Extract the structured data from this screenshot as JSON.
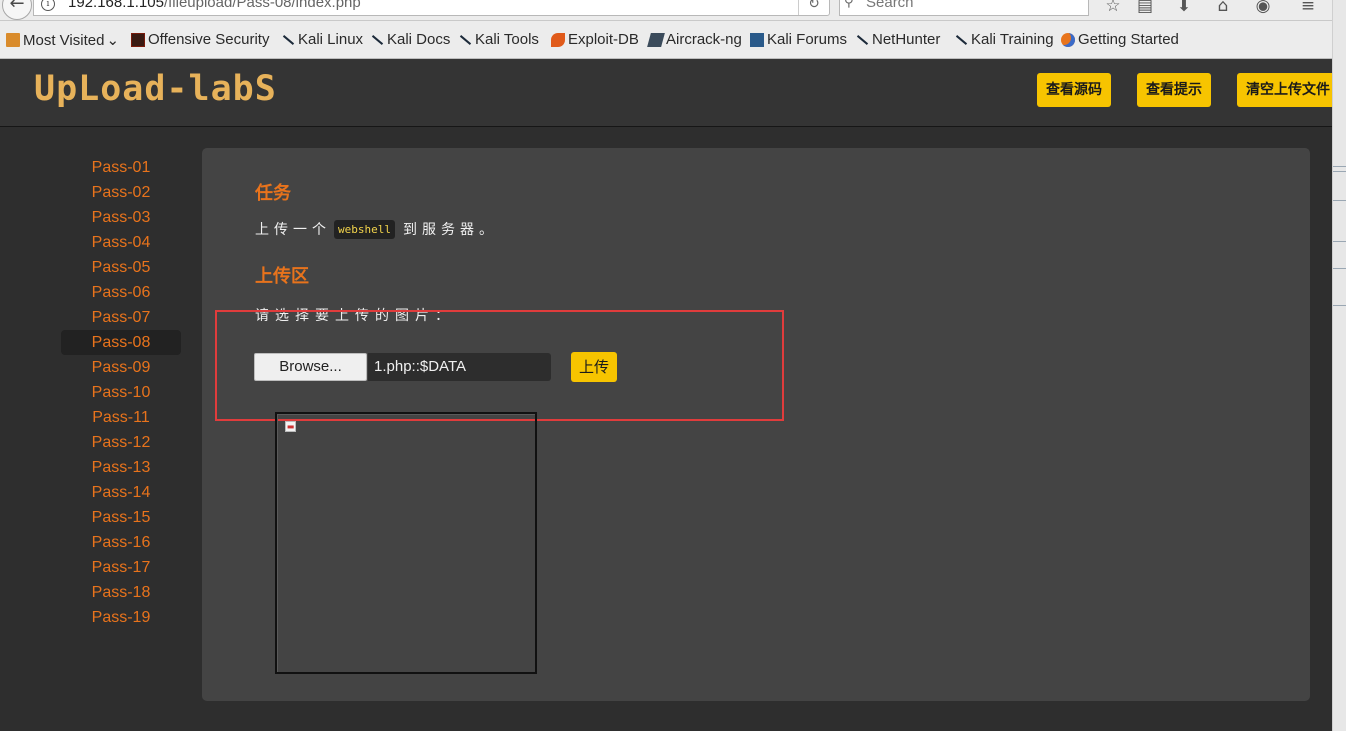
{
  "browser": {
    "url_host": "192.168.1.105",
    "url_path": "/fileupload/Pass-08/index.php",
    "search_placeholder": "Search",
    "bookmarks": [
      {
        "label": "Most Visited",
        "icon": "folder-icon"
      },
      {
        "label": "Offensive Security",
        "icon": "offsec-icon"
      },
      {
        "label": "Kali Linux",
        "icon": "kali-dragon-icon"
      },
      {
        "label": "Kali Docs",
        "icon": "kali-dragon-icon"
      },
      {
        "label": "Kali Tools",
        "icon": "kali-dragon-icon"
      },
      {
        "label": "Exploit-DB",
        "icon": "exploitdb-icon"
      },
      {
        "label": "Aircrack-ng",
        "icon": "aircrack-icon"
      },
      {
        "label": "Kali Forums",
        "icon": "kali-forums-icon"
      },
      {
        "label": "NetHunter",
        "icon": "kali-dragon-icon"
      },
      {
        "label": "Kali Training",
        "icon": "kali-dragon-icon"
      },
      {
        "label": "Getting Started",
        "icon": "firefox-icon"
      }
    ],
    "most_visited_chevron": "⌄"
  },
  "header": {
    "logo": "UpLoad-labS",
    "buttons": {
      "view_source": "查看源码",
      "view_hint": "查看提示",
      "clear_uploads": "清空上传文件"
    }
  },
  "sidebar": {
    "items": [
      "Pass-01",
      "Pass-02",
      "Pass-03",
      "Pass-04",
      "Pass-05",
      "Pass-06",
      "Pass-07",
      "Pass-08",
      "Pass-09",
      "Pass-10",
      "Pass-11",
      "Pass-12",
      "Pass-13",
      "Pass-14",
      "Pass-15",
      "Pass-16",
      "Pass-17",
      "Pass-18",
      "Pass-19"
    ],
    "active": "Pass-08"
  },
  "main": {
    "task_heading": "任务",
    "task_before": "上传一个",
    "task_code": "webshell",
    "task_after": "到服务器。",
    "upload_heading": "上传区",
    "choose_label": "请选择要上传的图片：",
    "browse_label": "Browse...",
    "file_name": "1.php::$DATA",
    "upload_button": "上传"
  },
  "colors": {
    "accent_orange": "#e8731c",
    "button_yellow": "#f7c400",
    "highlight_red": "#e03c3c",
    "panel_bg": "#444444"
  }
}
